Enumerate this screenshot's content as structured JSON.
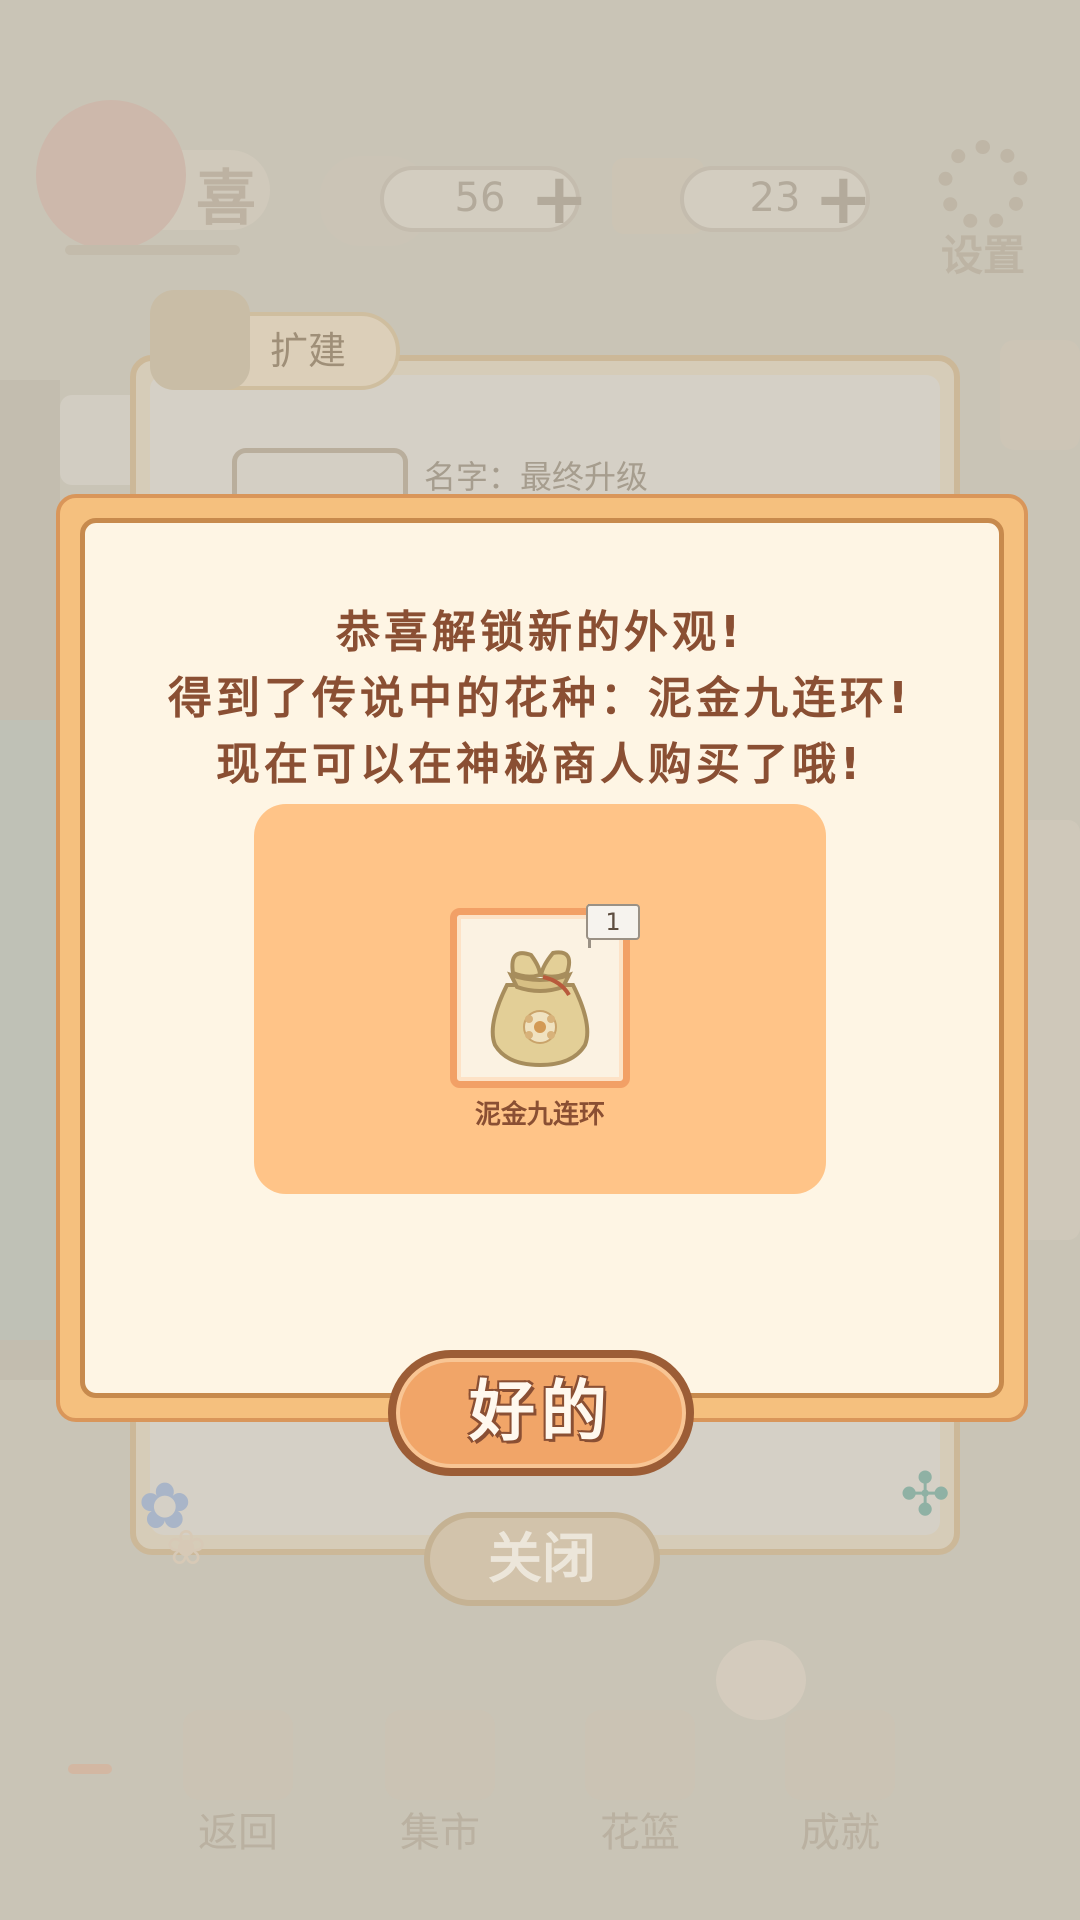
{
  "top_bar": {
    "logo_text": "喜",
    "fish_count": "56",
    "cheese_count": "23",
    "settings_label": "设置",
    "plus_symbol": "+"
  },
  "expand_panel": {
    "tab_label": "扩建",
    "item_name_label": "名字：最终升级",
    "close_label": "关闭"
  },
  "dialog": {
    "message_lines": [
      "恭喜解锁新的外观!",
      "得到了传说中的花种：泥金九连环!",
      "现在可以在神秘商人购买了哦!"
    ],
    "reward_item": {
      "name": "泥金九连环",
      "count": "1",
      "icon": "seed-bag-icon"
    },
    "ok_label": "好的"
  },
  "bottom_nav": [
    {
      "label": "返回",
      "icon": "return-icon"
    },
    {
      "label": "集市",
      "icon": "market-icon"
    },
    {
      "label": "花篮",
      "icon": "flower-basket-icon"
    },
    {
      "label": "成就",
      "icon": "trophy-icon"
    }
  ],
  "colors": {
    "dialog_border": "#f5c07e",
    "dialog_bg": "#fef5e4",
    "text_brown": "#8a4f33",
    "reward_bg": "#ffc488",
    "button_orange": "#f1a568"
  }
}
